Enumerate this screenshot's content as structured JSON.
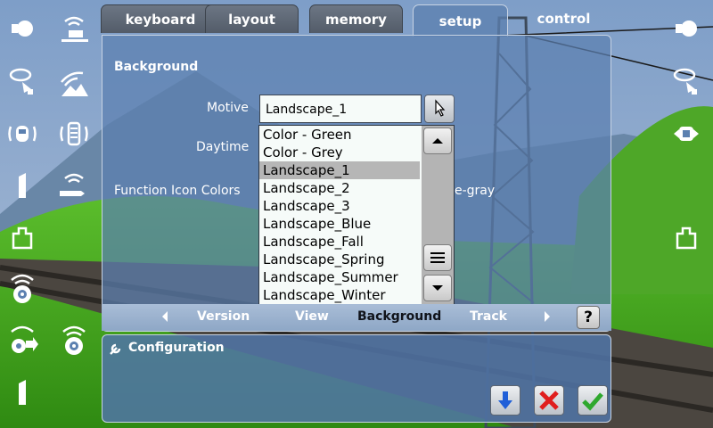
{
  "colors": {
    "accent": "#5c80b0",
    "check": "#2ea82e",
    "cross": "#e01e1e",
    "down_arrow": "#1f5fd8"
  },
  "tabs": [
    "keyboard",
    "layout",
    "memory",
    "setup",
    "control"
  ],
  "active_tab": "setup",
  "section_title": "Background",
  "motive": {
    "label": "Motive",
    "value": "Landscape_1"
  },
  "daytime": {
    "label": "Daytime"
  },
  "function_icon_colors": {
    "label": "Function Icon Colors",
    "value_partial": "e-gray"
  },
  "dropdown_options": [
    "Color - Green",
    "Color - Grey",
    "Landscape_1",
    "Landscape_2",
    "Landscape_3",
    "Landscape_Blue",
    "Landscape_Fall",
    "Landscape_Spring",
    "Landscape_Summer",
    "Landscape_Winter"
  ],
  "selected_option": "Landscape_1",
  "subtabs": {
    "items": [
      "Version",
      "View",
      "Background",
      "Track"
    ],
    "active": "Background",
    "help": "?"
  },
  "config": {
    "title": "Configuration"
  },
  "left_icons": [
    "light-icon",
    "wifi-decoder-icon",
    "loco-horn-icon",
    "wifi-mountain-icon",
    "signal-train-icon",
    "signal-tower-icon",
    "track-sensor-icon",
    "wifi-arrow-icon",
    "weight-icon",
    "wifi-target-icon",
    "radiation-arrow-icon",
    "wifi-target-icon",
    "track-sensor-icon"
  ],
  "right_icons": [
    "light-icon",
    "loco-horn-icon",
    "car-arrows-icon",
    "weight-icon"
  ]
}
